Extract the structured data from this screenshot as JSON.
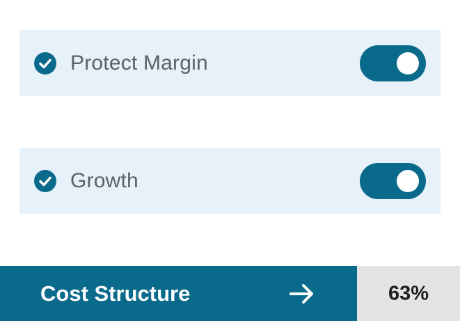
{
  "options": [
    {
      "label": "Protect Margin",
      "checked": true,
      "toggle_on": true,
      "check_icon": "check-circle-icon"
    },
    {
      "label": "Growth",
      "checked": true,
      "toggle_on": true,
      "check_icon": "check-circle-icon"
    }
  ],
  "footer": {
    "label": "Cost Structure",
    "arrow_icon": "arrow-right-icon",
    "value": "63%"
  },
  "colors": {
    "primary": "#0a6a8c",
    "row_background": "#e6f1f9",
    "value_background": "#e3e3e3",
    "label_text": "#5a6168",
    "value_text": "#1f1f1f"
  }
}
